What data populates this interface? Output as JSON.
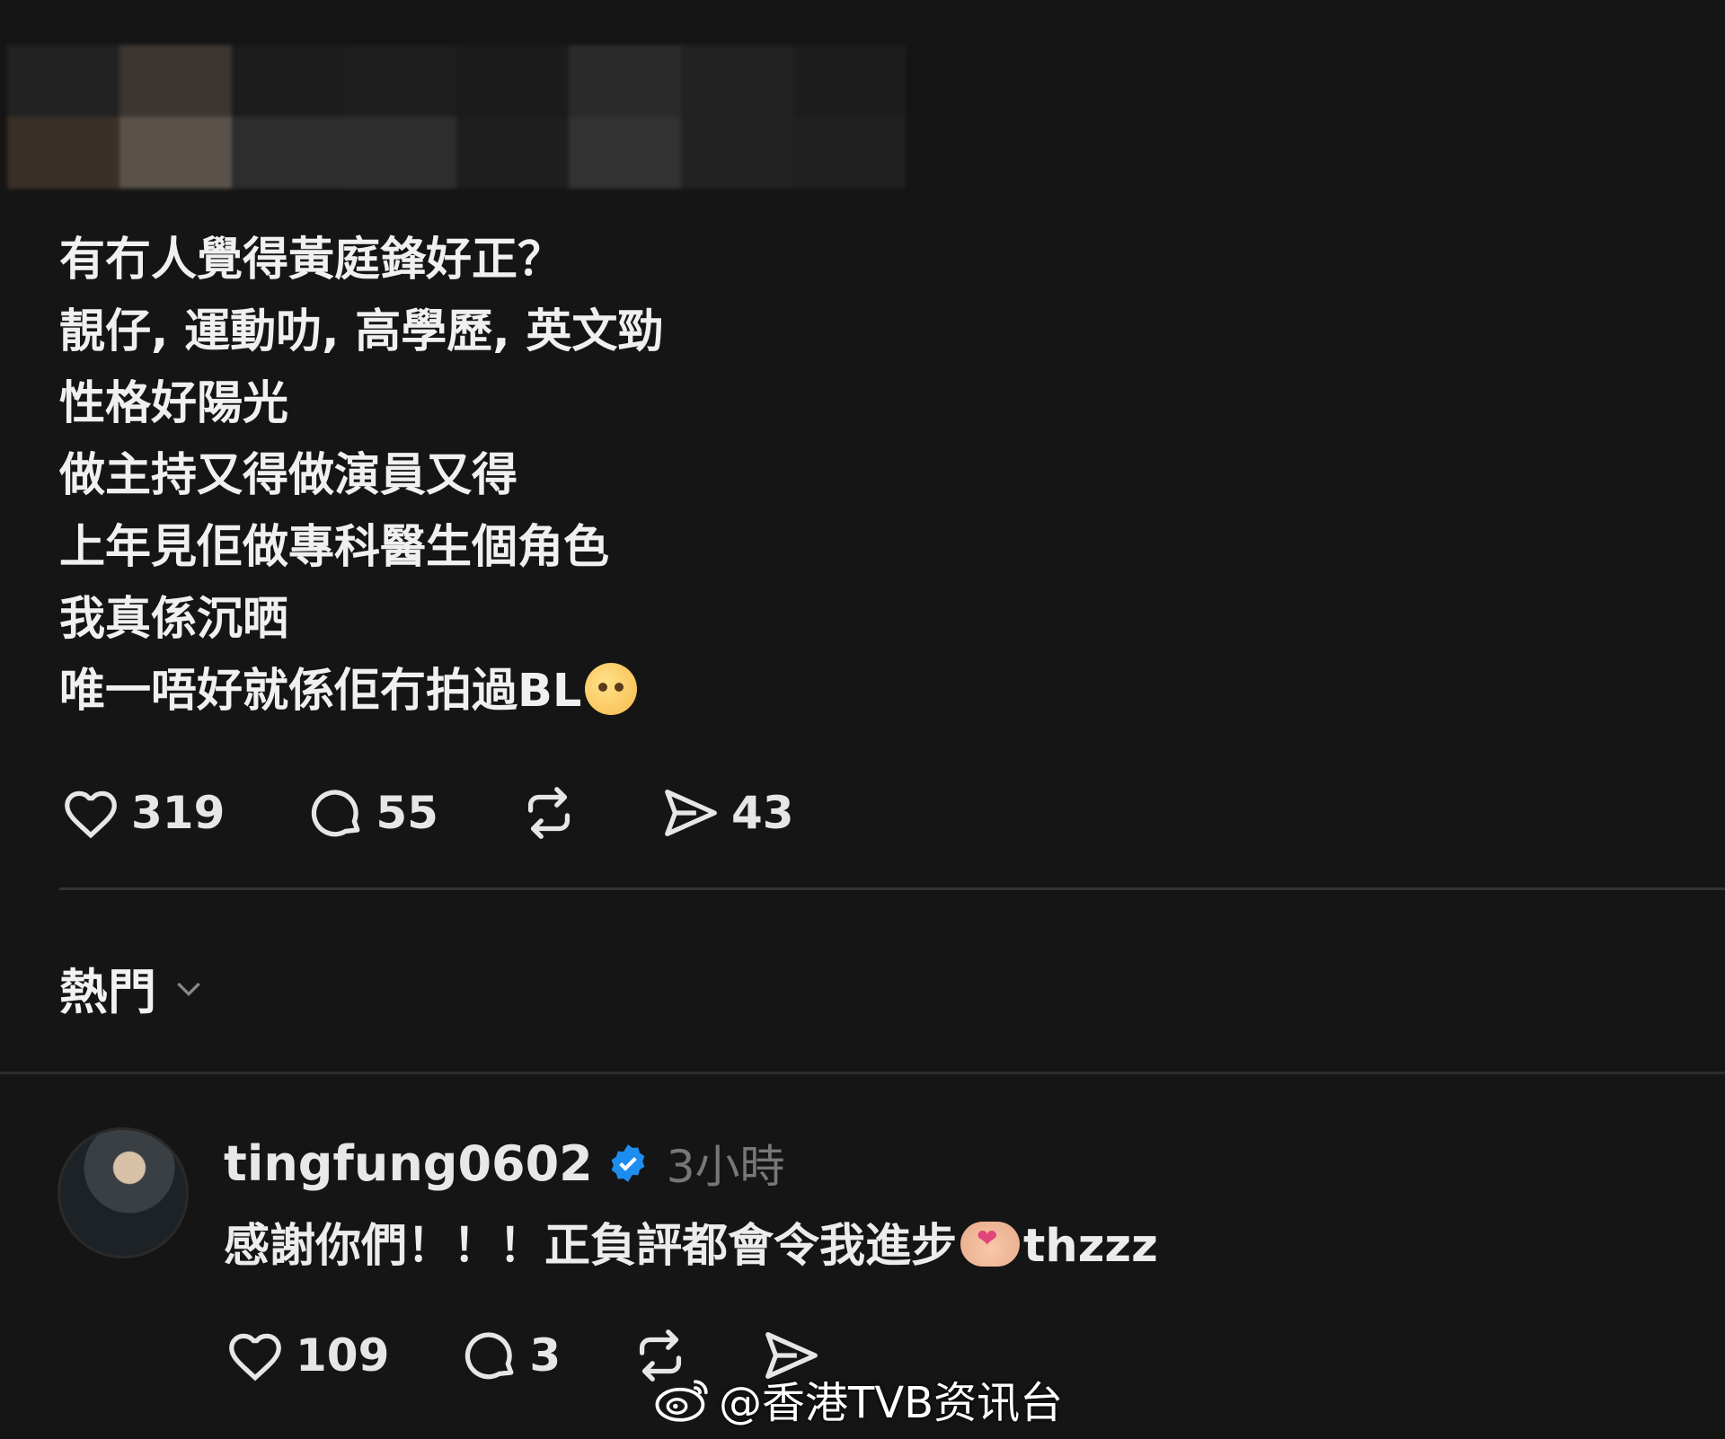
{
  "post": {
    "lines": [
      "有冇人覺得黃庭鋒好正？",
      "靚仔, 運動叻, 高學歷, 英文勁",
      "性格好陽光",
      "做主持又得做演員又得",
      "上年見佢做專科醫生個角色",
      "我真係沉晒",
      "唯一唔好就係佢冇拍過BL"
    ],
    "last_line_emoji": "pleading-face-emoji",
    "likes": "319",
    "comments": "55",
    "shares": "43"
  },
  "sort": {
    "label": "熱門"
  },
  "reply": {
    "username": "tingfung0602",
    "verified": true,
    "time": "3小時",
    "text_before": "感謝你們！！！正負評都會令我進步",
    "text_emoji": "heart-hands-emoji",
    "text_after": "thzzz",
    "likes": "109",
    "comments": "3"
  },
  "watermark": {
    "text": "@香港TVB资讯台"
  },
  "colors": {
    "background": "#151515",
    "verified": "#1d8df0",
    "muted": "#777777"
  }
}
